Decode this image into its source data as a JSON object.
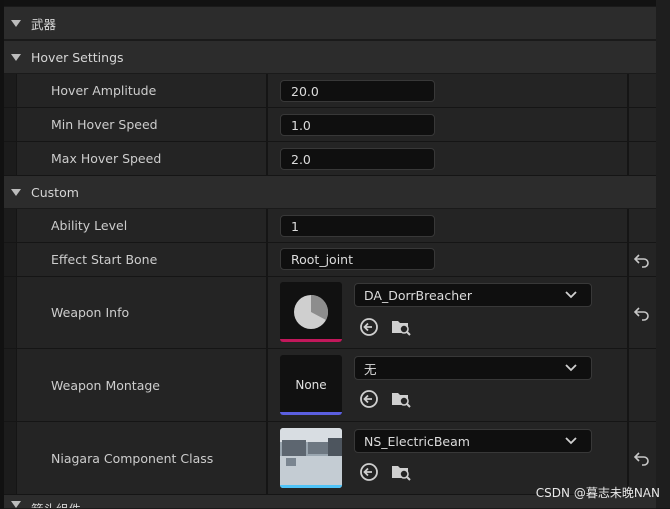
{
  "categories": {
    "weapon": "武器",
    "hover_settings": "Hover Settings",
    "custom": "Custom",
    "bottom": "箭头组件"
  },
  "hover": {
    "amplitude_label": "Hover Amplitude",
    "amplitude_value": "20.0",
    "min_label": "Min Hover Speed",
    "min_value": "1.0",
    "max_label": "Max Hover Speed",
    "max_value": "2.0"
  },
  "custom": {
    "ability_label": "Ability Level",
    "ability_value": "1",
    "bone_label": "Effect Start Bone",
    "bone_value": "Root_joint",
    "weapon_info_label": "Weapon Info",
    "weapon_info_value": "DA_DorrBreacher",
    "weapon_montage_label": "Weapon Montage",
    "weapon_montage_value": "无",
    "weapon_montage_thumb": "None",
    "niagara_label": "Niagara Component Class",
    "niagara_value": "NS_ElectricBeam"
  },
  "colors": {
    "data_asset_bar": "#c2185b",
    "anim_montage_bar": "#5b5fe0",
    "niagara_bar": "#4fc3f7"
  },
  "watermark": "CSDN @暮志未晚NAN"
}
